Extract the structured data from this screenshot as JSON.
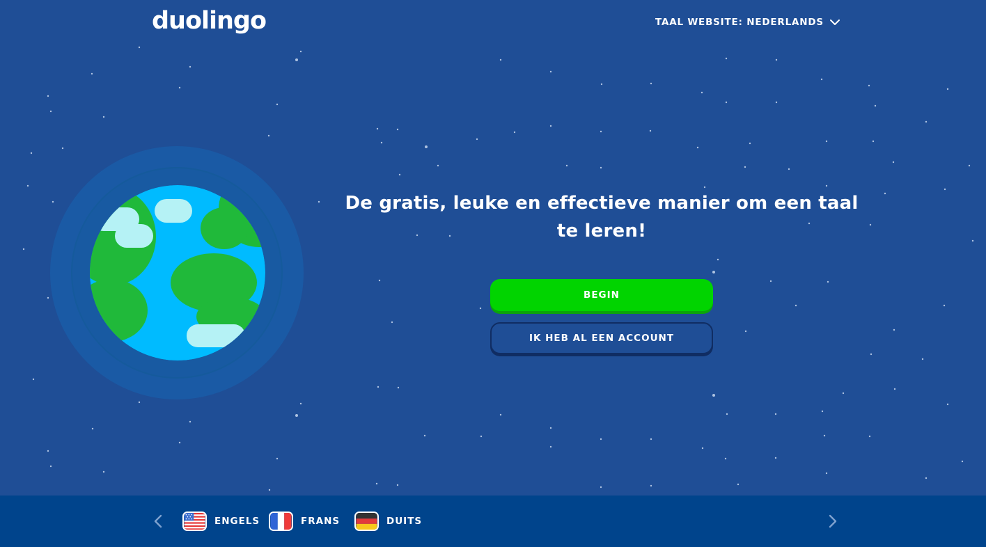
{
  "header": {
    "logo_text": "duolingo",
    "site_language_label": "TAAL WEBSITE: NEDERLANDS",
    "site_language_icon": "chevron-down-icon"
  },
  "hero": {
    "headline": "De gratis, leuke en effectieve manier om een taal te leren!",
    "primary_button_label": "BEGIN",
    "secondary_button_label": "IK HEB AL EEN ACCOUNT"
  },
  "footer": {
    "prev_icon": "chevron-left-icon",
    "next_icon": "chevron-right-icon",
    "languages": [
      {
        "label": "ENGELS",
        "flag": "us-flag-icon"
      },
      {
        "label": "FRANS",
        "flag": "france-flag-icon"
      },
      {
        "label": "DUITS",
        "flag": "germany-flag-icon"
      }
    ]
  },
  "colors": {
    "background": "#1f4e96",
    "footer_background": "#00448c",
    "primary_button": "#01d400",
    "ocean": "#00bbff",
    "land": "#20b93a",
    "cloud": "#b5f2f5"
  }
}
